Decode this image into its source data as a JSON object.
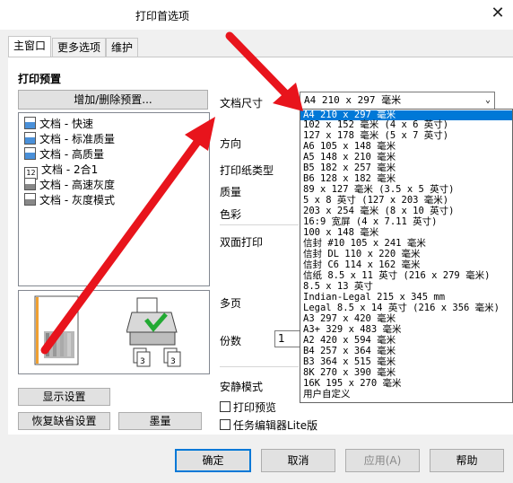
{
  "window": {
    "title": "打印首选项",
    "close_glyph": "✕"
  },
  "tabs": [
    {
      "label": "主窗口",
      "active": true
    },
    {
      "label": "更多选项",
      "active": false
    },
    {
      "label": "维护",
      "active": false
    }
  ],
  "presets": {
    "section_title": "打印预置",
    "add_remove_button": "增加/删除预置...",
    "items": [
      {
        "label": "文档 - 快速",
        "icon": "document-icon"
      },
      {
        "label": "文档 - 标准质量",
        "icon": "document-icon"
      },
      {
        "label": "文档 - 高质量",
        "icon": "document-icon"
      },
      {
        "label": "文档 - 2合1",
        "icon": "two-in-one-icon"
      },
      {
        "label": "文档 - 高速灰度",
        "icon": "grayscale-document-icon"
      },
      {
        "label": "文档 - 灰度模式",
        "icon": "grayscale-document-icon"
      }
    ]
  },
  "left_buttons": {
    "display_settings": "显示设置",
    "restore_defaults": "恢复缺省设置",
    "ink_levels": "墨量"
  },
  "settings": {
    "doc_size_label": "文档尺寸",
    "doc_size_value": "A4 210 x 297 毫米",
    "orientation_label": "方向",
    "paper_type_label": "打印纸类型",
    "quality_label": "质量",
    "color_label": "色彩",
    "duplex_label": "双面打印",
    "multipage_label": "多页",
    "copies_label": "份数",
    "copies_value": "1",
    "quiet_mode_label": "安静模式",
    "print_preview_label": "打印预览",
    "job_arranger_label": "任务编辑器Lite版"
  },
  "dropdown_options": [
    "A4 210 x 297 毫米",
    "102 x 152 毫米 (4 x 6 英寸)",
    "127 x 178 毫米 (5 x 7 英寸)",
    "A6 105 x 148 毫米",
    "A5 148 x 210 毫米",
    "B5 182 x 257 毫米",
    "B6 128 x 182 毫米",
    "89 x 127 毫米 (3.5 x 5 英寸)",
    "5 x 8 英寸 (127 x 203 毫米)",
    "203 x 254 毫米 (8 x 10 英寸)",
    "16:9 宽屏 (4 x 7.11 英寸)",
    "100 x 148 毫米",
    "信封 #10 105 x 241 毫米",
    "信封 DL 110 x 220 毫米",
    "信封 C6  114 x 162 毫米",
    "信纸 8.5 x 11 英寸 (216 x 279 毫米)",
    "8.5 x 13 英寸",
    "Indian-Legal 215 x 345 mm",
    "Legal 8.5 x 14 英寸 (216 x 356 毫米)",
    "A3 297 x 420 毫米",
    "A3+ 329 x 483 毫米",
    "A2 420 x 594 毫米",
    "B4 257 x 364 毫米",
    "B3 364 x 515 毫米",
    "8K 270 x 390 毫米",
    "16K 195 x 270 毫米",
    "用户自定义"
  ],
  "dialog_buttons": {
    "ok": "确定",
    "cancel": "取消",
    "apply": "应用(A)",
    "help": "帮助"
  },
  "colors": {
    "selection": "#0078d7",
    "annotation_arrow": "#e8141c"
  }
}
